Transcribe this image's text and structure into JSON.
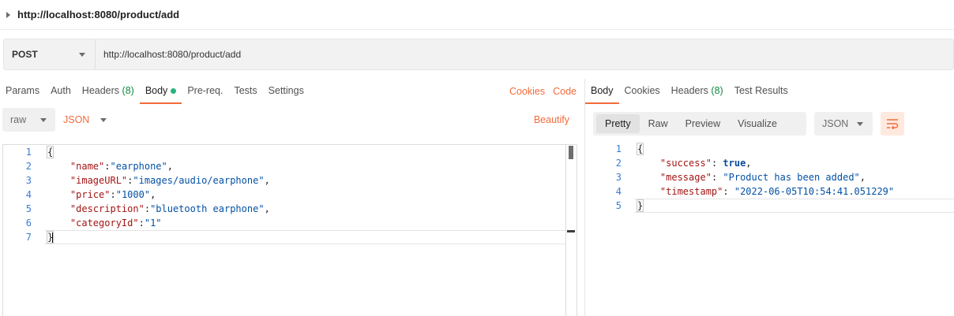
{
  "request_title": "http://localhost:8080/product/add",
  "method": "POST",
  "url": "http://localhost:8080/product/add",
  "request_tabs": [
    {
      "label": "Params"
    },
    {
      "label": "Auth"
    },
    {
      "label": "Headers",
      "count": "(8)"
    },
    {
      "label": "Body"
    },
    {
      "label": "Pre-req."
    },
    {
      "label": "Tests"
    },
    {
      "label": "Settings"
    }
  ],
  "links": {
    "cookies": "Cookies",
    "code": "Code",
    "beautify": "Beautify"
  },
  "body_mode": "raw",
  "body_language": "JSON",
  "request_body": {
    "line_numbers": [
      "1",
      "2",
      "3",
      "4",
      "5",
      "6",
      "7"
    ],
    "open": "{",
    "close": "}",
    "fields": [
      {
        "key": "\"name\"",
        "value": "\"earphone\"",
        "comma": ","
      },
      {
        "key": "\"imageURL\"",
        "value": "\"images/audio/earphone\"",
        "comma": ","
      },
      {
        "key": "\"price\"",
        "value": "\"1000\"",
        "comma": ","
      },
      {
        "key": "\"description\"",
        "value": "\"bluetooth earphone\"",
        "comma": ","
      },
      {
        "key": "\"categoryId\"",
        "value": "\"1\"",
        "comma": ""
      }
    ]
  },
  "response_tabs": [
    {
      "label": "Body"
    },
    {
      "label": "Cookies"
    },
    {
      "label": "Headers",
      "count": "(8)"
    },
    {
      "label": "Test Results"
    }
  ],
  "view_modes": [
    "Pretty",
    "Raw",
    "Preview",
    "Visualize"
  ],
  "response_format": "JSON",
  "response_body": {
    "line_numbers": [
      "1",
      "2",
      "3",
      "4",
      "5"
    ],
    "open": "{",
    "close": "}",
    "fields": [
      {
        "key": "\"success\"",
        "value": "true",
        "comma": ","
      },
      {
        "key": "\"message\"",
        "value": "\"Product has been added\"",
        "comma": ","
      },
      {
        "key": "\"timestamp\"",
        "value": "\"2022-06-05T10:54:41.051229\"",
        "comma": ""
      }
    ]
  },
  "colors": {
    "accent": "#f26b3a",
    "count_green": "#0f8a44",
    "dot_green": "#26b47f",
    "line_number": "#3a7bd5",
    "json_key": "#a31515",
    "json_string": "#0451a5"
  },
  "icons": {
    "collapse": "caret-right-icon",
    "dropdown": "chevron-down-icon",
    "wrap": "wrap-lines-icon",
    "modified": "dot-icon"
  }
}
